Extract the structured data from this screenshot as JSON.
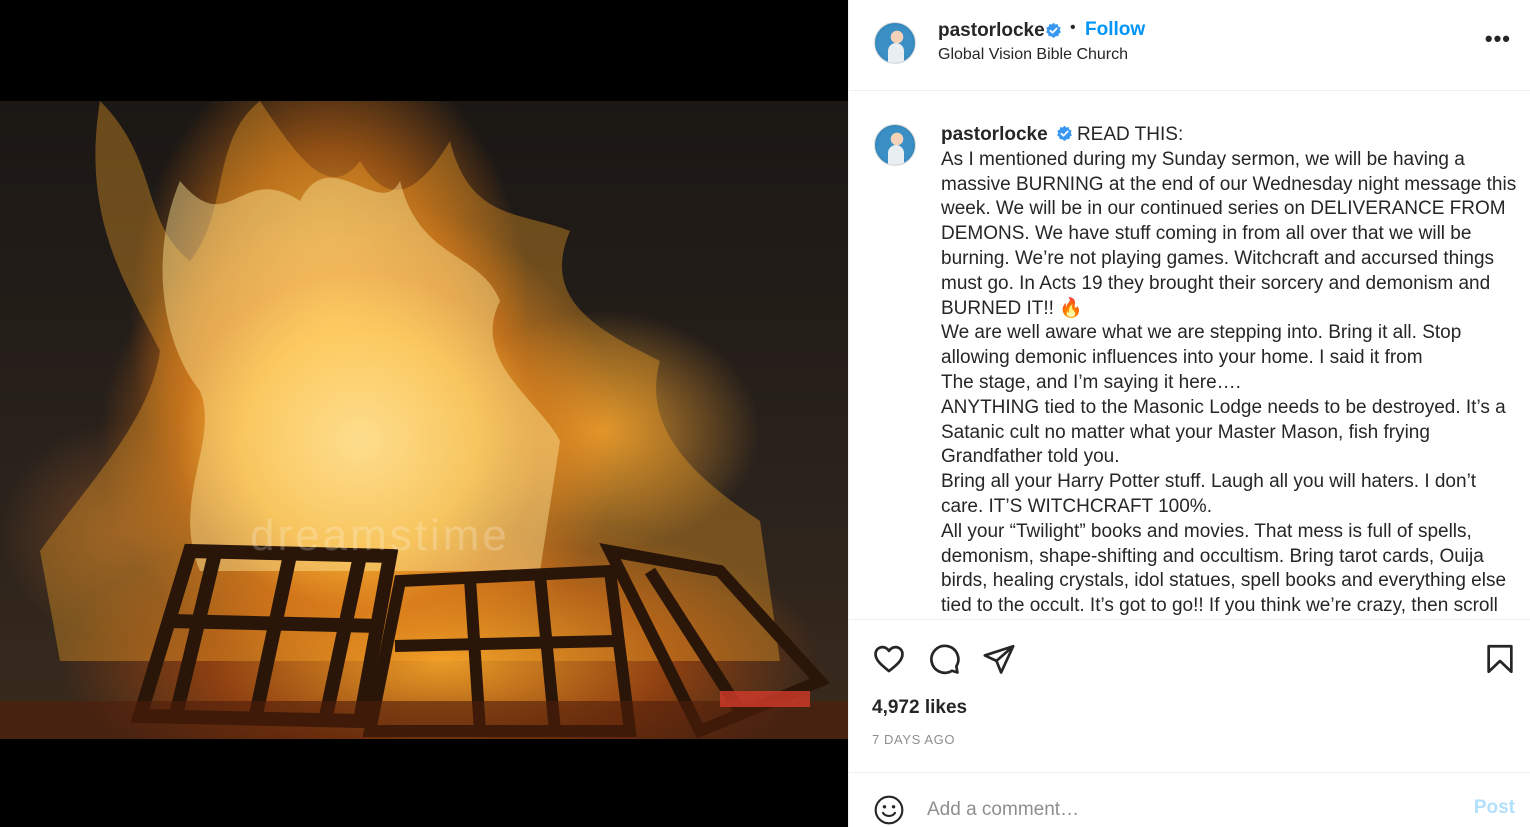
{
  "post": {
    "image_alt": "Large bonfire of burning wooden pallets at night",
    "watermark": "dreamstime"
  },
  "header": {
    "username": "pastorlocke",
    "separator": "•",
    "follow_label": "Follow",
    "location": "Global Vision Bible Church",
    "more_label": "•••"
  },
  "caption": {
    "username": "pastorlocke",
    "first_line": "READ THIS:",
    "lines": [
      "As I mentioned during my Sunday sermon, we will be having a",
      "massive BURNING at the end of our Wednesday night message this",
      "week. We will be in our continued series on DELIVERANCE FROM",
      "DEMONS. We have stuff coming in from all over that we will be",
      "burning. We’re not playing games. Witchcraft and accursed things",
      "must go. In Acts 19 they brought their sorcery and demonism and",
      "BURNED IT!! 🔥",
      "We are well aware what we are stepping into. Bring it all. Stop",
      "allowing demonic influences into your home. I said it from",
      "The stage, and I’m saying it here….",
      "ANYTHING tied to the Masonic Lodge needs to be destroyed. It’s a",
      "Satanic cult no matter what your Master Mason, fish frying",
      "Grandfather told you.",
      "Bring all your Harry Potter stuff. Laugh all you will haters. I don’t",
      "care. IT’S WITCHCRAFT 100%.",
      "All your “Twilight” books and movies. That mess is full of spells,",
      "demonism, shape-shifting and occultism. Bring tarot cards, Ouija",
      "birds, healing crystals, idol statues, spell books and everything else",
      "tied to the occult. It’s got to go!! If you think we’re crazy, then scroll"
    ]
  },
  "stats": {
    "likes": "4,972 likes",
    "time_ago": "7 DAYS AGO"
  },
  "comment": {
    "placeholder": "Add a comment…",
    "post_label": "Post"
  },
  "icons": {
    "like": "heart-icon",
    "comment": "comment-bubble-icon",
    "share": "paper-plane-icon",
    "save": "bookmark-icon",
    "emoji": "smiley-icon",
    "verified": "verified-badge-icon"
  },
  "colors": {
    "link_blue": "#0095f6",
    "verified_blue": "#3897f0",
    "muted_text": "#8e8e8e",
    "post_disabled": "#b2dffc"
  }
}
